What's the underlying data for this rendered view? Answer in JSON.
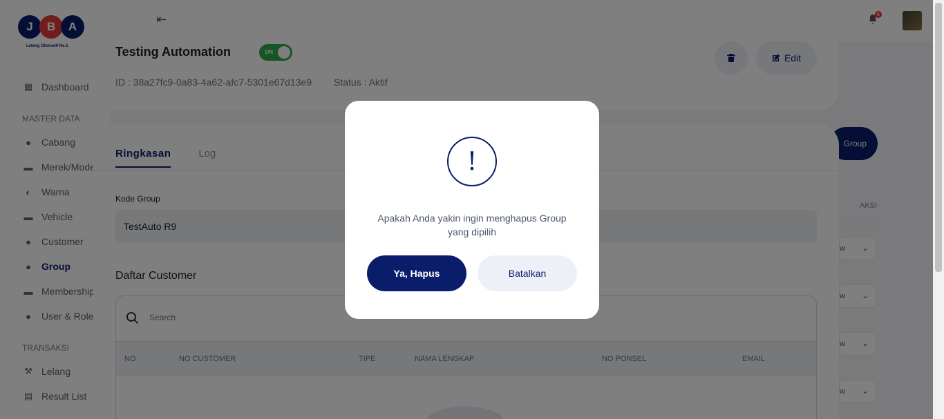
{
  "brand": {
    "letters": [
      "J",
      "B",
      "A"
    ],
    "tagline": "Lelang Otomotif No.1",
    "colors": {
      "navy": "#0a1d6b",
      "red": "#e33b3b"
    }
  },
  "sidebar": {
    "sections": [
      {
        "title": "MASTER DATA"
      },
      {
        "title": "TRANSAKSI"
      }
    ],
    "items": [
      {
        "label": "Dashboard",
        "icon": "dashboard-icon"
      },
      {
        "label": "Cabang",
        "icon": "location-pin-icon"
      },
      {
        "label": "Merek/Model",
        "icon": "car-icon"
      },
      {
        "label": "Warna",
        "icon": "palette-icon"
      },
      {
        "label": "Vehicle",
        "icon": "car-icon"
      },
      {
        "label": "Customer",
        "icon": "user-icon"
      },
      {
        "label": "Group",
        "icon": "users-icon",
        "active": true
      },
      {
        "label": "Membership",
        "icon": "car-icon"
      },
      {
        "label": "User & Role",
        "icon": "user-role-icon"
      },
      {
        "label": "Lelang",
        "icon": "gavel-icon"
      },
      {
        "label": "Result List",
        "icon": "database-icon"
      }
    ]
  },
  "topbar": {
    "notification_count": "6"
  },
  "background_page": {
    "add_button_label": "Group",
    "column_aksi": "AKSI",
    "row_text": "w"
  },
  "group": {
    "name": "Testing Automation",
    "toggle_label": "ON",
    "id_text": "ID : 38a27fc9-0a83-4a62-afc7-5301e67d13e9",
    "status_text": "Status : Aktif",
    "edit_label": "Edit"
  },
  "tabs": [
    {
      "label": "Ringkasan",
      "active": true
    },
    {
      "label": "Log",
      "active": false
    }
  ],
  "form": {
    "kode_label": "Kode Group",
    "kode_value": "TestAuto R9"
  },
  "customers": {
    "title": "Daftar Customer",
    "search_placeholder": "Search",
    "columns": [
      "NO",
      "NO CUSTOMER",
      "TIPE",
      "NAMA LENGKAP",
      "NO PONSEL",
      "EMAIL"
    ]
  },
  "modal": {
    "icon": "exclamation-icon",
    "message": "Apakah Anda yakin ingin menghapus Group yang dipilih",
    "confirm_label": "Ya, Hapus",
    "cancel_label": "Batalkan"
  }
}
